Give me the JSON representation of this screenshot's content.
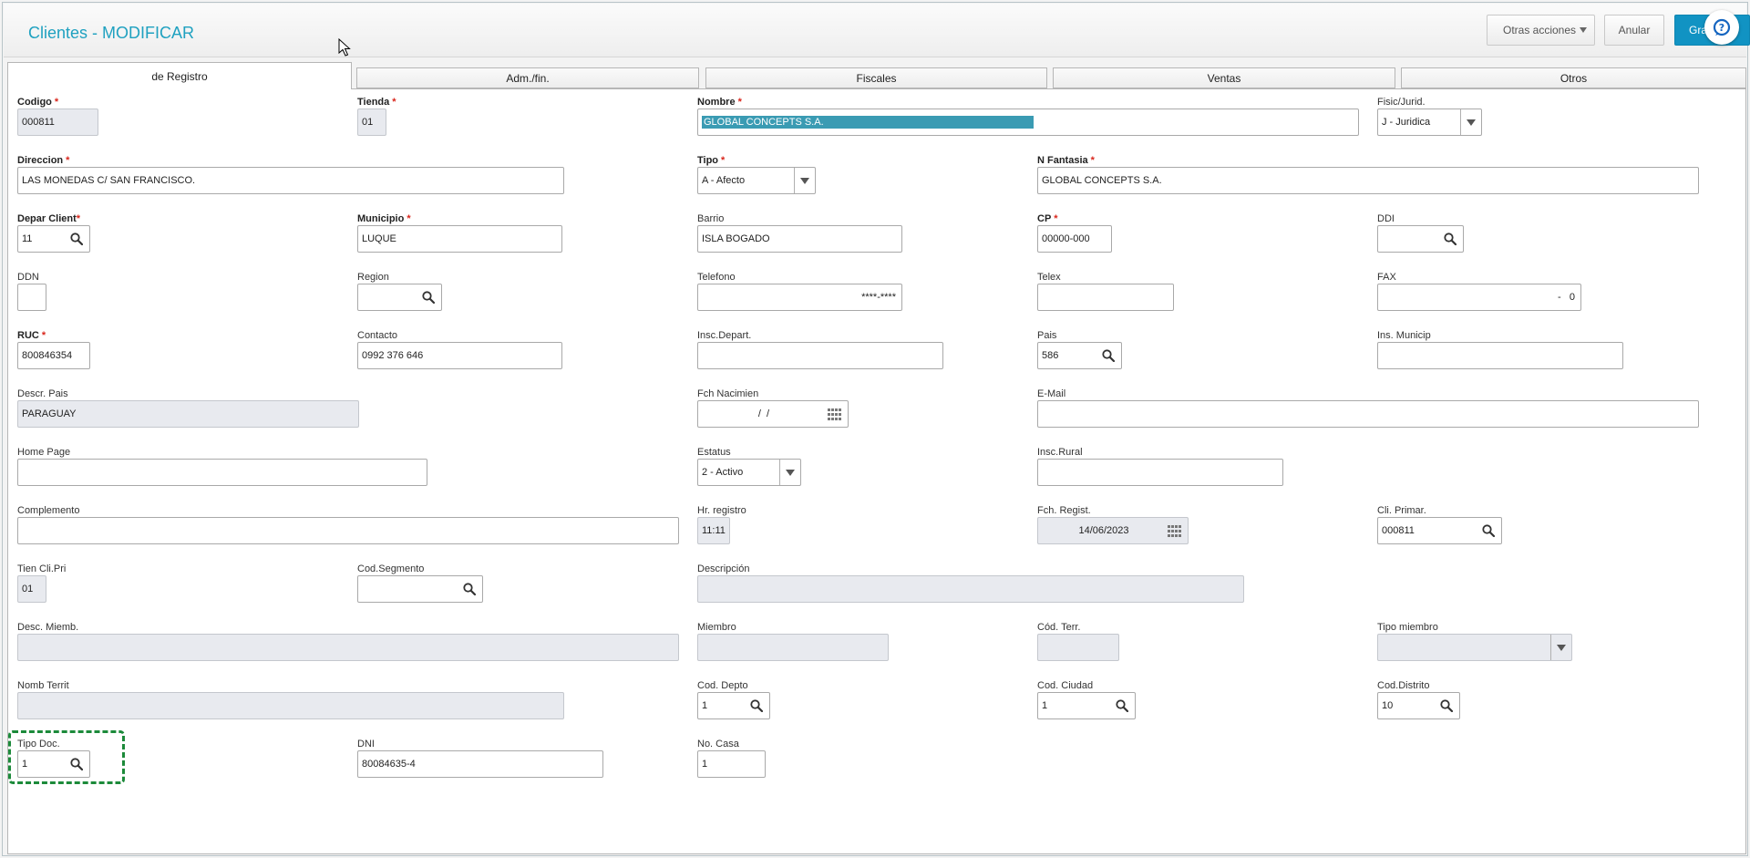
{
  "header": {
    "title": "Clientes - MODIFICAR",
    "more_actions": "Otras acciones",
    "cancel": "Anular",
    "save": "Grabar"
  },
  "tabs": [
    {
      "label": "de Registro",
      "active": true
    },
    {
      "label": "Adm./fin."
    },
    {
      "label": "Fiscales"
    },
    {
      "label": "Ventas"
    },
    {
      "label": "Otros"
    }
  ],
  "form": {
    "codigo": {
      "label": "Codigo",
      "value": "000811"
    },
    "tienda": {
      "label": "Tienda",
      "value": "01"
    },
    "nombre": {
      "label": "Nombre",
      "value": "GLOBAL CONCEPTS S.A."
    },
    "fisic_jurid": {
      "label": "Fisic/Jurid.",
      "value": "J - Juridica"
    },
    "direccion": {
      "label": "Direccion",
      "value": "LAS MONEDAS C/ SAN FRANCISCO."
    },
    "tipo": {
      "label": "Tipo",
      "value": "A - Afecto"
    },
    "n_fantasia": {
      "label": "N Fantasia",
      "value": "GLOBAL CONCEPTS S.A."
    },
    "depar_client": {
      "label": "Depar Client",
      "value": "11"
    },
    "municipio": {
      "label": "Municipio",
      "value": "LUQUE"
    },
    "barrio": {
      "label": "Barrio",
      "value": "ISLA BOGADO"
    },
    "cp": {
      "label": "CP",
      "value": "00000-000"
    },
    "ddi": {
      "label": "DDI",
      "value": ""
    },
    "ddn": {
      "label": "DDN",
      "value": ""
    },
    "region": {
      "label": "Region",
      "value": ""
    },
    "telefono": {
      "label": "Telefono",
      "value": "****-****"
    },
    "telex": {
      "label": "Telex",
      "value": ""
    },
    "fax": {
      "label": "FAX",
      "value": "-   0"
    },
    "ruc": {
      "label": "RUC",
      "value": "800846354"
    },
    "contacto": {
      "label": "Contacto",
      "value": "0992 376 646"
    },
    "insc_depart": {
      "label": "Insc.Depart.",
      "value": ""
    },
    "pais": {
      "label": "Pais",
      "value": "586"
    },
    "ins_municip": {
      "label": "Ins. Municip",
      "value": ""
    },
    "descr_pais": {
      "label": "Descr. Pais",
      "value": "PARAGUAY"
    },
    "fch_nacimien": {
      "label": "Fch Nacimien",
      "value": "/  /"
    },
    "email": {
      "label": "E-Mail",
      "value": ""
    },
    "home_page": {
      "label": "Home Page",
      "value": ""
    },
    "estatus": {
      "label": "Estatus",
      "value": "2 - Activo"
    },
    "insc_rural": {
      "label": "Insc.Rural",
      "value": ""
    },
    "complemento": {
      "label": "Complemento",
      "value": ""
    },
    "hr_registro": {
      "label": "Hr. registro",
      "value": "11:11"
    },
    "fch_regist": {
      "label": "Fch. Regist.",
      "value": "14/06/2023"
    },
    "cli_primar": {
      "label": "Cli. Primar.",
      "value": "000811"
    },
    "tien_cli_pri": {
      "label": "Tien Cli.Pri",
      "value": "01"
    },
    "cod_segmento": {
      "label": "Cod.Segmento",
      "value": ""
    },
    "descripcion": {
      "label": "Descripción",
      "value": ""
    },
    "desc_miemb": {
      "label": "Desc. Miemb.",
      "value": ""
    },
    "miembro": {
      "label": "Miembro",
      "value": ""
    },
    "cod_terr": {
      "label": "Cód. Terr.",
      "value": ""
    },
    "tipo_miembro": {
      "label": "Tipo miembro",
      "value": ""
    },
    "nomb_territ": {
      "label": "Nomb Territ",
      "value": ""
    },
    "cod_depto": {
      "label": "Cod. Depto",
      "value": "1"
    },
    "cod_ciudad": {
      "label": "Cod. Ciudad",
      "value": "1"
    },
    "cod_distrito": {
      "label": "Cod.Distrito",
      "value": "10"
    },
    "tipo_doc": {
      "label": "Tipo Doc.",
      "value": "1"
    },
    "dni": {
      "label": "DNI",
      "value": "80084635-4"
    },
    "no_casa": {
      "label": "No. Casa",
      "value": "1"
    }
  },
  "colors": {
    "accent": "#1fa1c0",
    "save_button": "#1193c3",
    "required": "#d9261c",
    "focus_ring": "#1c8a3a"
  }
}
